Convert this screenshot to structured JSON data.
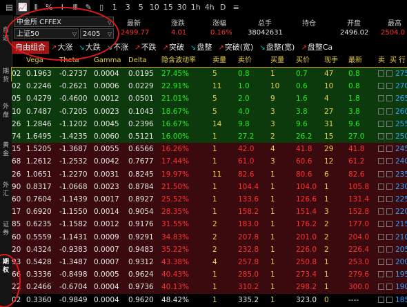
{
  "toolbar": {
    "items": [
      "▤",
      "📈",
      "Ⅱ",
      "%",
      "Ⅰ",
      "Ⅲ",
      "✎",
      "▯",
      "1",
      "3",
      "5",
      "10",
      "15",
      "30",
      "1h",
      "4h",
      "D",
      "≡"
    ]
  },
  "sidebar": {
    "items": [
      {
        "label": "自选",
        "active": false
      },
      {
        "label": "期货",
        "active": false
      },
      {
        "label": "外盘",
        "active": false
      },
      {
        "label": "黄金",
        "active": false
      },
      {
        "label": "外汇",
        "active": false
      },
      {
        "label": "证券",
        "active": false
      },
      {
        "label": "期权",
        "active": true
      }
    ]
  },
  "instrument": {
    "exchange": "中金所 CFFEX",
    "underlying": "上证50",
    "expiry": "2405"
  },
  "quote": {
    "labels": {
      "last": "最新",
      "chg": "涨跌",
      "pct": "涨幅",
      "vol": "总手",
      "oi": "持仓",
      "open": "开盘",
      "high": "最高"
    },
    "last": "2499.77",
    "chg": "4.01",
    "pct": "0.16%",
    "vol": "38042631",
    "oi": "",
    "open": "2496.02",
    "high": "2504.0"
  },
  "tabs": [
    {
      "label": "自由组合",
      "icon": "",
      "active": true
    },
    {
      "label": "大涨",
      "icon": "up-arrow",
      "active": false
    },
    {
      "label": "大跌",
      "icon": "down-arrow",
      "active": false
    },
    {
      "label": "不涨",
      "icon": "down-arrow",
      "active": false
    },
    {
      "label": "不跌",
      "icon": "up-arrow",
      "active": false
    },
    {
      "label": "突破",
      "icon": "up-arrow",
      "active": false
    },
    {
      "label": "盘整",
      "icon": "down-arrow",
      "active": false
    },
    {
      "label": "突破(宽)",
      "icon": "up-arrow",
      "active": false
    },
    {
      "label": "盘整(宽)",
      "icon": "down-arrow",
      "active": false
    },
    {
      "label": "盘整Ca",
      "icon": "up-arrow",
      "active": false
    }
  ],
  "columns": [
    "Vega",
    "Theta",
    "Gamma",
    "Delta",
    "隐含波动率",
    "卖量",
    "卖价",
    "买量",
    "买价",
    "现手",
    "最新",
    "卖",
    "买",
    "行"
  ],
  "rows": [
    {
      "k": "02",
      "vega": "0.1963",
      "theta": "-0.2737",
      "gamma": "0.0004",
      "delta": "0.0195",
      "iv": "27.45%",
      "sv": "5",
      "sp": "0.8",
      "bv": "1",
      "bp": "0.7",
      "cur": "47",
      "last": "0.8",
      "strike": "275",
      "zone": "g",
      "selected": true
    },
    {
      "k": "02",
      "vega": "0.2246",
      "theta": "-0.2621",
      "gamma": "0.0006",
      "delta": "0.0229",
      "iv": "22.91%",
      "sv": "11",
      "sp": "1.0",
      "bv": "10",
      "bp": "0.6",
      "cur": "10",
      "last": "0.8",
      "strike": "270",
      "zone": "g"
    },
    {
      "k": "05",
      "vega": "0.4279",
      "theta": "-0.4600",
      "gamma": "0.0012",
      "delta": "0.0501",
      "iv": "21.01%",
      "sv": "5",
      "sp": "2.0",
      "bv": "9",
      "bp": "1.6",
      "cur": "4",
      "last": "1.8",
      "strike": "265",
      "zone": "g"
    },
    {
      "k": "10",
      "vega": "0.7487",
      "theta": "-0.7205",
      "gamma": "0.0023",
      "delta": "0.1043",
      "iv": "18.67%",
      "sv": "5",
      "sp": "4.0",
      "bv": "3",
      "bp": "3.8",
      "cur": "27",
      "last": "3.8",
      "strike": "260",
      "zone": "g"
    },
    {
      "k": "26",
      "vega": "1.2846",
      "theta": "-1.1202",
      "gamma": "0.0045",
      "delta": "0.2396",
      "iv": "16.67%",
      "sv": "14",
      "sp": "9.8",
      "bv": "3",
      "bp": "9.6",
      "cur": "31",
      "last": "9.6",
      "strike": "255",
      "zone": "g"
    },
    {
      "k": "74",
      "vega": "1.6495",
      "theta": "-1.4235",
      "gamma": "0.0060",
      "delta": "0.5121",
      "iv": "16.00%",
      "sv": "1",
      "sp": "27.2",
      "bv": "2",
      "bp": "26.2",
      "cur": "15",
      "last": "27.0",
      "strike": "250",
      "zone": "g"
    },
    {
      "k": "15",
      "vega": "1.5205",
      "theta": "-1.3687",
      "gamma": "0.0055",
      "delta": "0.6566",
      "iv": "16.26%",
      "sv": "1",
      "sp": "42.0",
      "bv": "4",
      "bp": "41.8",
      "cur": "29",
      "last": "41.8",
      "strike": "245",
      "zone": "r"
    },
    {
      "k": "68",
      "vega": "1.2612",
      "theta": "-1.2532",
      "gamma": "0.0042",
      "delta": "0.7677",
      "iv": "17.44%",
      "sv": "1",
      "sp": "61.0",
      "bv": "3",
      "bp": "60.6",
      "cur": "12",
      "last": "61.2",
      "strike": "240",
      "zone": "r"
    },
    {
      "k": "26",
      "vega": "1.0651",
      "theta": "-1.2270",
      "gamma": "0.0031",
      "delta": "0.8245",
      "iv": "19.97%",
      "sv": "11",
      "sp": "82.6",
      "bv": "1",
      "bp": "80.6",
      "cur": "6",
      "last": "82.6",
      "strike": "235",
      "zone": "r"
    },
    {
      "k": "90",
      "vega": "0.8317",
      "theta": "-1.0668",
      "gamma": "0.0023",
      "delta": "0.8784",
      "iv": "21.50%",
      "sv": "1",
      "sp": "104.4",
      "bv": "1",
      "bp": "104.0",
      "cur": "1",
      "last": "105.8",
      "strike": "230",
      "zone": "r"
    },
    {
      "k": "60",
      "vega": "0.7604",
      "theta": "-1.1439",
      "gamma": "0.0017",
      "delta": "0.8927",
      "iv": "25.52%",
      "sv": "1",
      "sp": "133.6",
      "bv": "1",
      "bp": "126.6",
      "cur": "1",
      "last": "131.4",
      "strike": "225",
      "zone": "r"
    },
    {
      "k": "17",
      "vega": "0.6920",
      "theta": "-1.1550",
      "gamma": "0.0014",
      "delta": "0.9054",
      "iv": "28.35%",
      "sv": "1",
      "sp": "158.2",
      "bv": "1",
      "bp": "151.4",
      "cur": "3",
      "last": "152.8",
      "strike": "220",
      "zone": "r"
    },
    {
      "k": "85",
      "vega": "0.6235",
      "theta": "-1.1582",
      "gamma": "0.0012",
      "delta": "0.9176",
      "iv": "31.55%",
      "sv": "2",
      "sp": "183.0",
      "bv": "1",
      "bp": "176.2",
      "cur": "2",
      "last": "177.0",
      "strike": "215",
      "zone": "r"
    },
    {
      "k": "60",
      "vega": "0.5559",
      "theta": "-1.1431",
      "gamma": "0.0009",
      "delta": "0.9291",
      "iv": "34.83%",
      "sv": "2",
      "sp": "207.8",
      "bv": "1",
      "bp": "201.0",
      "cur": "2",
      "last": "204.0",
      "strike": "210",
      "zone": "r"
    },
    {
      "k": "20",
      "vega": "0.4324",
      "theta": "-0.9383",
      "gamma": "0.0007",
      "delta": "0.9483",
      "iv": "35.22%",
      "sv": "2",
      "sp": "232.8",
      "bv": "1",
      "bp": "226.0",
      "cur": "2",
      "last": "226.4",
      "strike": "205",
      "zone": "r"
    },
    {
      "k": "93",
      "vega": "0.5428",
      "theta": "-1.3487",
      "gamma": "0.0007",
      "delta": "0.9312",
      "iv": "43.38%",
      "sv": "4",
      "sp": "257.8",
      "bv": "1",
      "bp": "250.8",
      "cur": "1",
      "last": "253.0",
      "strike": "200",
      "zone": "r"
    },
    {
      "k": "66",
      "vega": "0.3336",
      "theta": "-0.8498",
      "gamma": "0.0005",
      "delta": "0.9624",
      "iv": "40.43%",
      "sv": "1",
      "sp": "285.0",
      "bv": "1",
      "bp": "273.4",
      "cur": "1",
      "last": "279.6",
      "strike": "195",
      "zone": "r"
    },
    {
      "k": "22",
      "vega": "0.2466",
      "theta": "-0.6704",
      "gamma": "0.0004",
      "delta": "0.9736",
      "iv": "40.13%",
      "sv": "1",
      "sp": "310.2",
      "bv": "1",
      "bp": "298.2",
      "cur": "1",
      "last": "300.0",
      "strike": "190",
      "zone": "r"
    },
    {
      "k": "02",
      "vega": "0.3360",
      "theta": "-0.9849",
      "gamma": "0.0004",
      "delta": "0.9620",
      "iv": "48.42%",
      "sv": "1",
      "sp": "335.2",
      "bv": "1",
      "bp": "323.0",
      "cur": "0",
      "last": "----",
      "strike": "185",
      "zone": "k"
    }
  ],
  "colors": {
    "accent": "#e21a1a",
    "green_zone": "#0c3a0c",
    "red_zone": "#3a0a0e",
    "header": "#e8d24a"
  }
}
